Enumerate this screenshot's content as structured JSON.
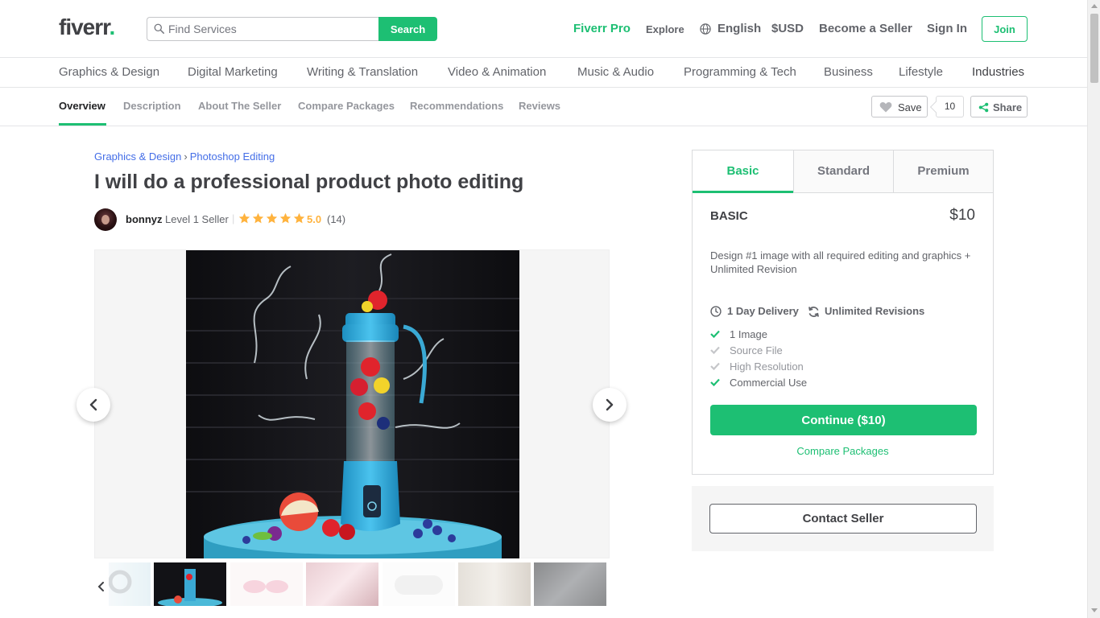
{
  "header": {
    "logo": "fiverr",
    "logo_dot": ".",
    "search_placeholder": "Find Services",
    "search_button": "Search",
    "nav": {
      "pro": "Fiverr Pro",
      "explore": "Explore",
      "language": "English",
      "currency": "$USD",
      "become_seller": "Become a Seller",
      "sign_in": "Sign In",
      "join": "Join"
    }
  },
  "categories": [
    "Graphics & Design",
    "Digital Marketing",
    "Writing & Translation",
    "Video & Animation",
    "Music & Audio",
    "Programming & Tech",
    "Business",
    "Lifestyle",
    "Industries"
  ],
  "subnav": {
    "tabs": [
      "Overview",
      "Description",
      "About The Seller",
      "Compare Packages",
      "Recommendations",
      "Reviews"
    ],
    "save_label": "Save",
    "save_count": "10",
    "share_label": "Share"
  },
  "breadcrumb": {
    "category": "Graphics & Design",
    "separator": "›",
    "subcategory": "Photoshop Editing"
  },
  "gig": {
    "title": "I will do a professional product photo editing",
    "seller_name": "bonnyz",
    "seller_level": "Level 1 Seller",
    "rating_divider": "|",
    "rating": "5.0",
    "reviews_count": "(14)",
    "stars_filled": 5
  },
  "package": {
    "tabs": [
      "Basic",
      "Standard",
      "Premium"
    ],
    "active_tab": "Basic",
    "name": "BASIC",
    "price": "$10",
    "description": "Design #1 image with all required editing and graphics + Unlimited Revision",
    "delivery": "1 Day Delivery",
    "revisions": "Unlimited Revisions",
    "features": [
      {
        "label": "1 Image",
        "included": true
      },
      {
        "label": "Source File",
        "included": false
      },
      {
        "label": "High Resolution",
        "included": false
      },
      {
        "label": "Commercial Use",
        "included": true
      }
    ],
    "continue_label": "Continue ($10)",
    "compare_label": "Compare Packages",
    "contact_label": "Contact Seller"
  },
  "colors": {
    "brand_green": "#1dbf73",
    "link_blue": "#446ee7",
    "star_gold": "#ffb33e",
    "text_dark": "#404145"
  }
}
